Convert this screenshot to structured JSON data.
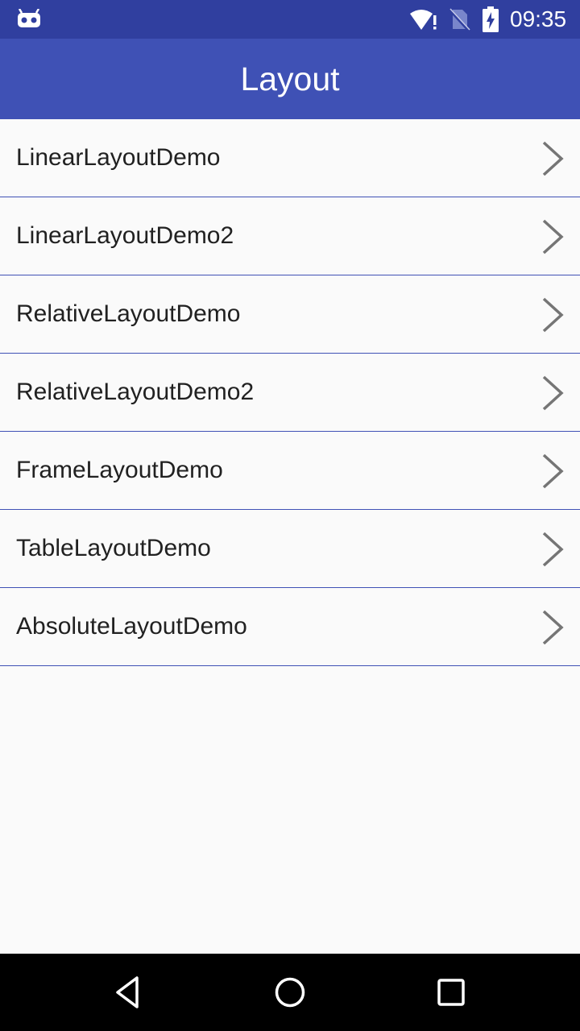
{
  "status_bar": {
    "time": "09:35",
    "icons": [
      "robot-icon",
      "wifi-icon",
      "no-sim-icon",
      "battery-charging-icon"
    ],
    "background": "#303f9f"
  },
  "app_bar": {
    "title": "Layout",
    "background": "#3f51b5"
  },
  "list": {
    "items": [
      {
        "label": "LinearLayoutDemo"
      },
      {
        "label": "LinearLayoutDemo2"
      },
      {
        "label": "RelativeLayoutDemo"
      },
      {
        "label": "RelativeLayoutDemo2"
      },
      {
        "label": "FrameLayoutDemo"
      },
      {
        "label": "TableLayoutDemo"
      },
      {
        "label": "AbsoluteLayoutDemo"
      }
    ],
    "divider_color": "#3f51b5",
    "chevron_icon": "chevron-right-icon"
  },
  "nav_bar": {
    "buttons": [
      "back-icon",
      "home-icon",
      "recents-icon"
    ],
    "background": "#000000"
  }
}
